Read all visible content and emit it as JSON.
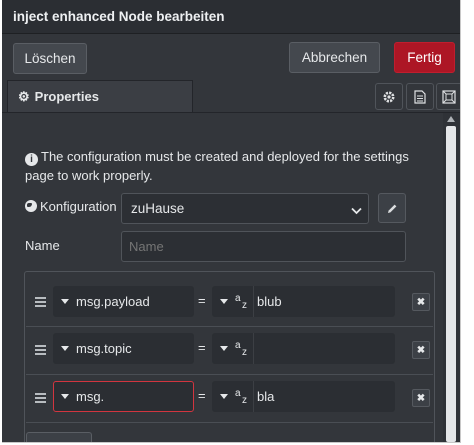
{
  "dialog": {
    "title": "inject enhanced Node bearbeiten"
  },
  "toolbar": {
    "delete_label": "Löschen",
    "cancel_label": "Abbrechen",
    "done_label": "Fertig"
  },
  "tabs": {
    "properties_label": "Properties",
    "icons": [
      "gear-icon",
      "description-icon",
      "appearance-icon"
    ]
  },
  "form": {
    "info_text": "The configuration must be created and deployed for the settings page to work properly.",
    "config_label": "Konfiguration",
    "config_value": "zuHause",
    "name_label": "Name",
    "name_placeholder": "Name",
    "name_value": ""
  },
  "properties": [
    {
      "property": "msg.payload",
      "operator": "=",
      "value_type": "string",
      "value": "blub"
    },
    {
      "property": "msg.topic",
      "operator": "=",
      "value_type": "string",
      "value": ""
    },
    {
      "property": "msg.",
      "operator": "=",
      "value_type": "string",
      "value": "bla",
      "invalid": true
    }
  ],
  "colors": {
    "primary_button": "#ad1625",
    "panel_bg": "#33363b",
    "invalid_border": "#d2353f"
  }
}
